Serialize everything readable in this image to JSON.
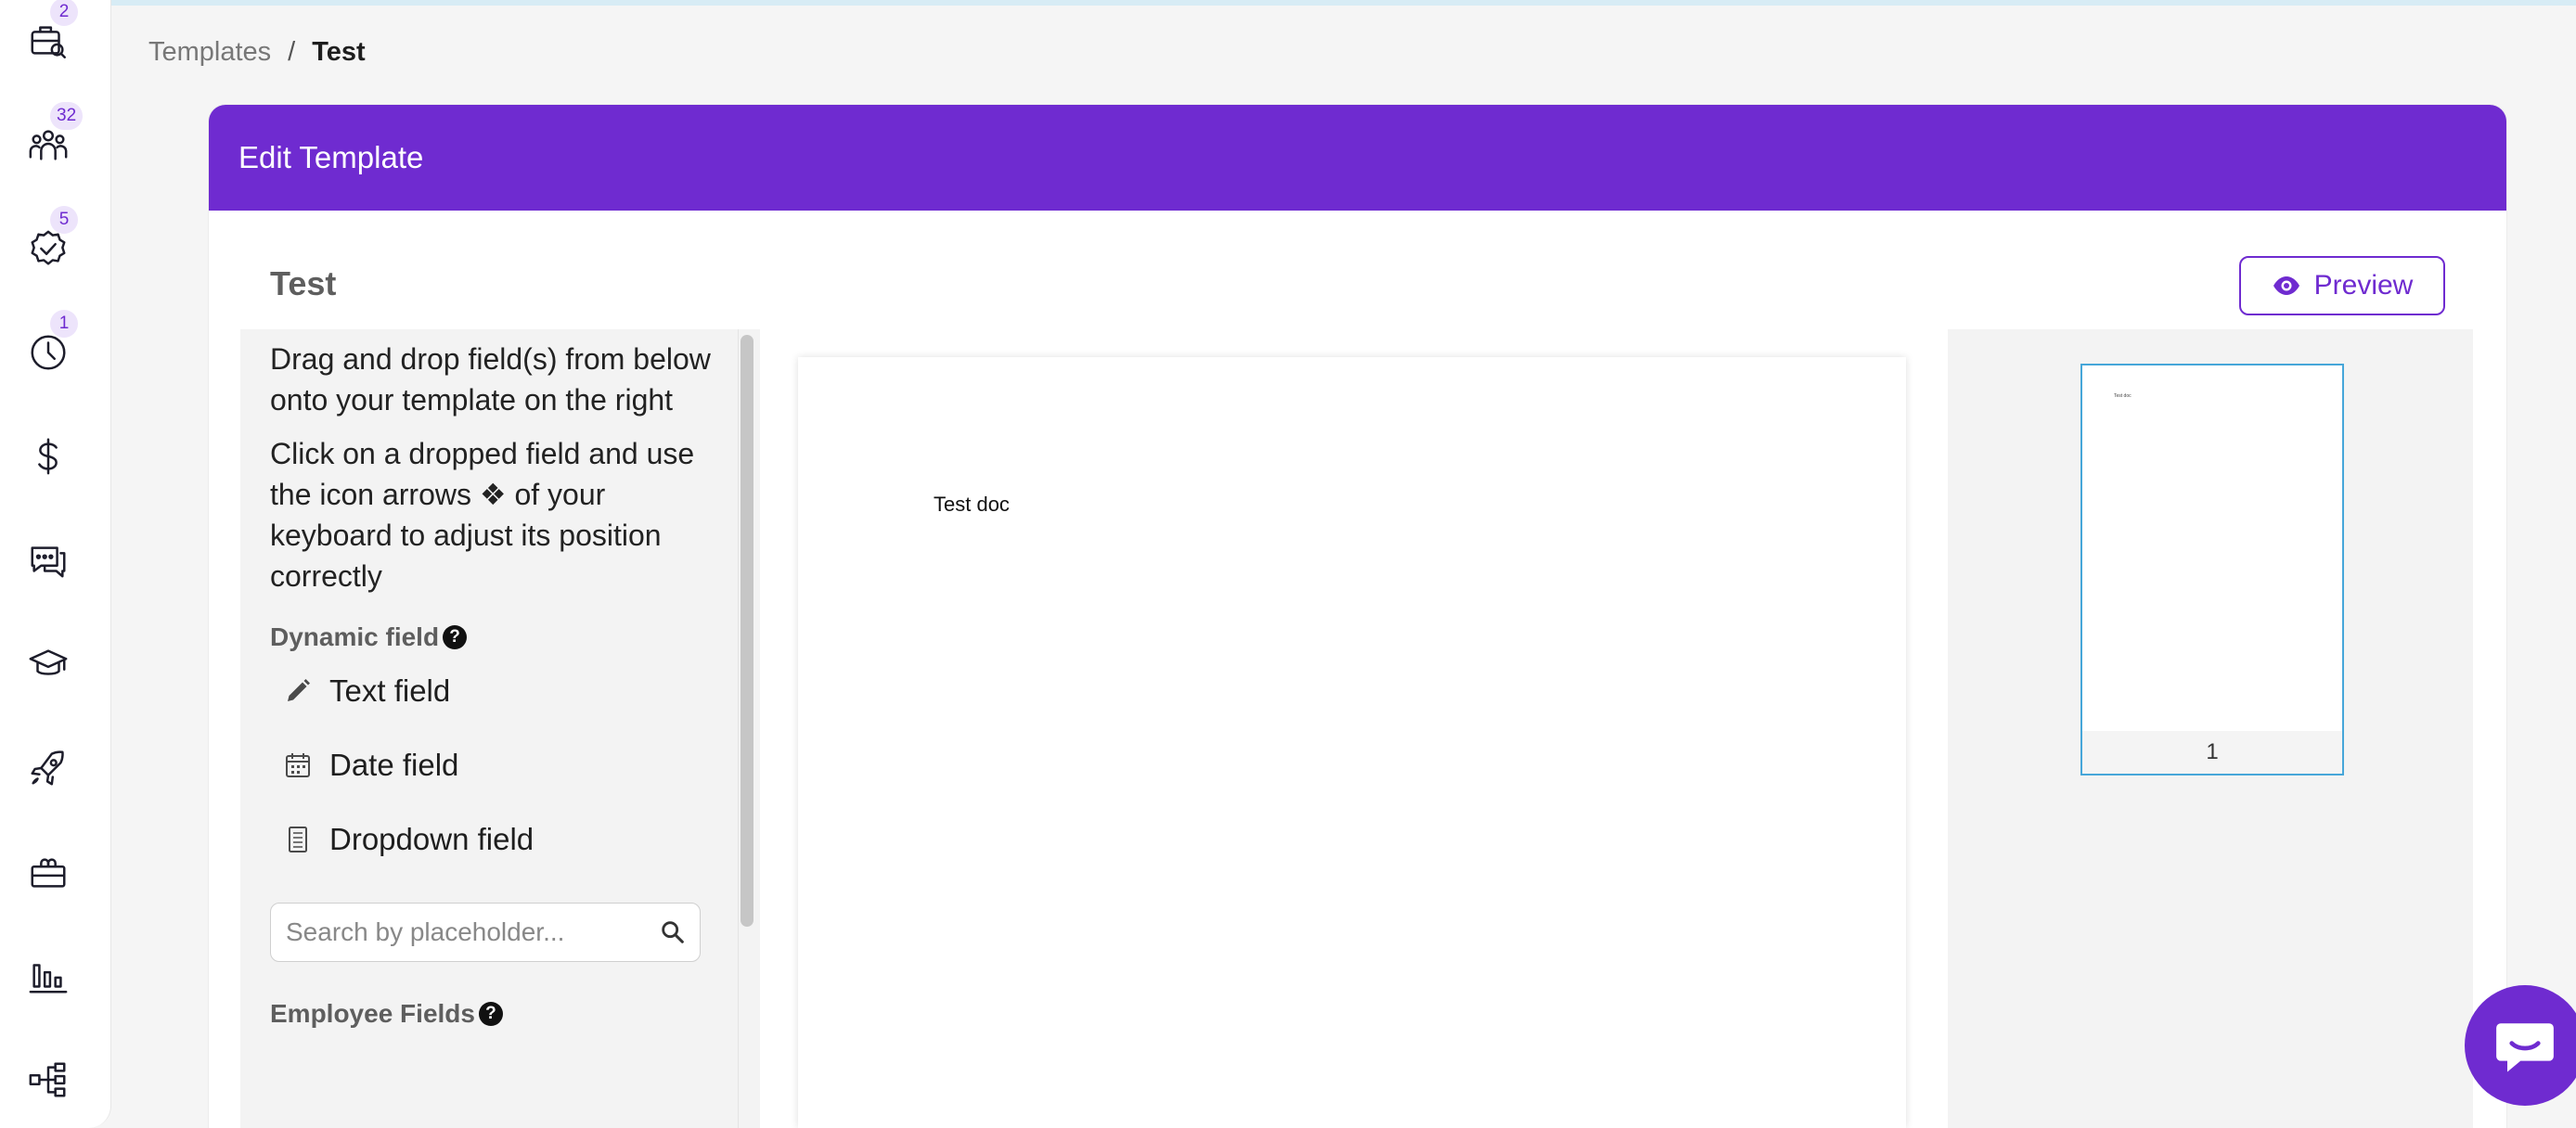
{
  "sidebar": {
    "items": [
      {
        "name": "briefcase-search",
        "badge": "2"
      },
      {
        "name": "people",
        "badge": "32"
      },
      {
        "name": "check-badge",
        "badge": "5"
      },
      {
        "name": "clock",
        "badge": "1"
      },
      {
        "name": "dollar",
        "badge": ""
      },
      {
        "name": "chat-bubbles",
        "badge": ""
      },
      {
        "name": "graduation-cap",
        "badge": ""
      },
      {
        "name": "rocket",
        "badge": ""
      },
      {
        "name": "gift",
        "badge": ""
      },
      {
        "name": "bar-chart",
        "badge": ""
      },
      {
        "name": "org-chart",
        "badge": ""
      }
    ]
  },
  "breadcrumb": {
    "parent": "Templates",
    "separator": "/",
    "current": "Test"
  },
  "card": {
    "header_title": "Edit Template",
    "doc_title": "Test",
    "preview_label": "Preview"
  },
  "left_panel": {
    "instruction_1": "Drag and drop field(s) from below onto your template on the right",
    "instruction_2": "Click on a dropped field and use the icon arrows ❖ of your keyboard to adjust its position correctly",
    "dynamic_title": "Dynamic field",
    "fields": {
      "text": "Text field",
      "date": "Date field",
      "dropdown": "Dropdown field"
    },
    "search_placeholder": "Search by placeholder...",
    "employee_title": "Employee Fields"
  },
  "canvas": {
    "text": "Test doc"
  },
  "thumbnail": {
    "page_number": "1",
    "text": "Test doc"
  },
  "colors": {
    "brand": "#6f2bd0",
    "thumb_border": "#46a6d9"
  }
}
